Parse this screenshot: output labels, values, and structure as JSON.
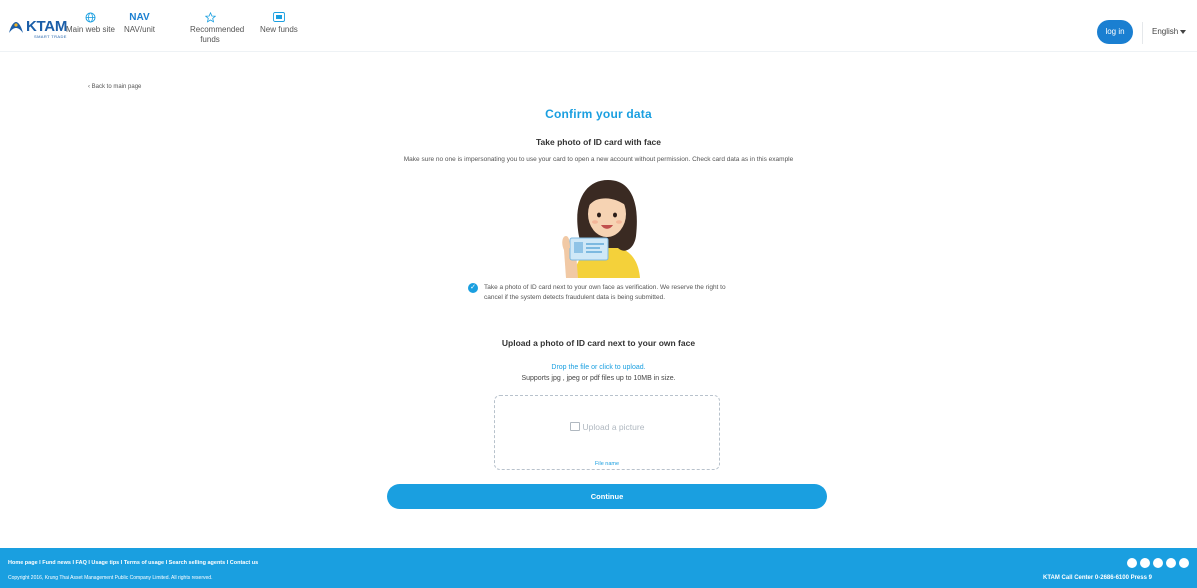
{
  "header": {
    "logo_text": "KTAM",
    "logo_sub": "SMART TRADE",
    "nav": [
      {
        "label": "Main web site",
        "icon": "globe-icon"
      },
      {
        "label": "NAV/unit",
        "icon": "nav-text",
        "icon_text": "NAV"
      },
      {
        "label": "Recommended funds",
        "icon": "star-icon"
      },
      {
        "label": "New funds",
        "icon": "new-badge-icon"
      }
    ],
    "login_label": "log in",
    "language": "English"
  },
  "main": {
    "back_label": "Back to main page",
    "title": "Confirm your data",
    "subtitle": "Take photo of ID card with face",
    "description": "Make sure no one is impersonating you to use your card to open a new account without permission. Check card data as in this example",
    "check_text": "Take a photo of ID card next to your own face as verification. We reserve the right to cancel if the system detects fraudulent data is being submitted.",
    "upload_title": "Upload a photo of ID card next to your own face",
    "drop_link": "Drop the file or click to upload.",
    "support_text": "Supports jpg , jpeg or pdf files up to 10MB in size.",
    "upload_placeholder": "Upload a picture",
    "file_name_label": "File name",
    "continue_label": "Continue"
  },
  "footer": {
    "links": "Home page I Fund news I FAQ I Usage tips I Terms of usage I Search selling agents I Contact us",
    "copyright": "Copyright 2016, Krung Thai Asset Management Public Company Limited. All rights reserved.",
    "call_center": "KTAM Call Center 0-2686-6100 Press 9"
  },
  "colors": {
    "accent": "#1a9fe0",
    "brand": "#1b5ea8",
    "login": "#1a7fd1"
  }
}
